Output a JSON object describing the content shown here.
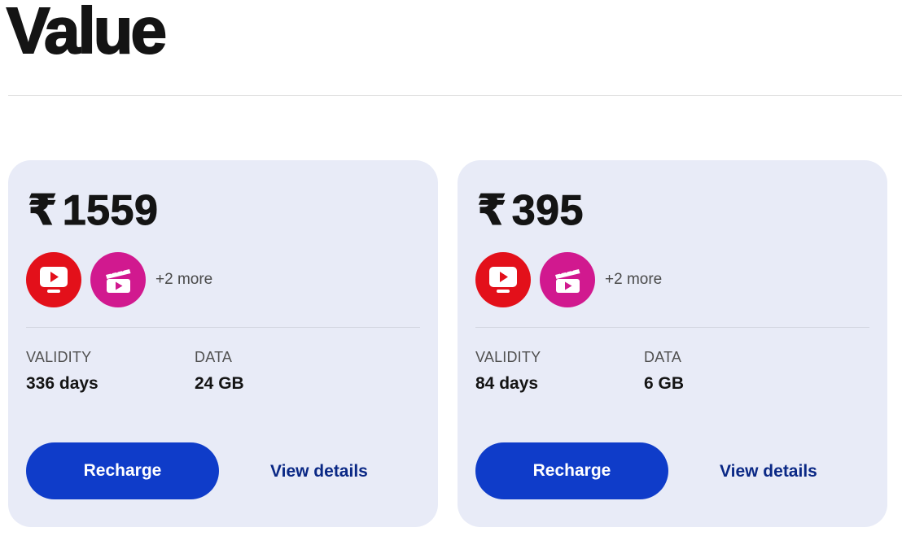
{
  "page": {
    "title": "Value"
  },
  "colors": {
    "card_background": "#e8ebf7",
    "recharge_button": "#0f3cc9",
    "link": "#0a2885",
    "tv_icon_bg": "#e3101a",
    "cinema_icon_bg": "#d1198f"
  },
  "plans": [
    {
      "currency": "₹",
      "price": "1559",
      "ott_icons": [
        "jiotv-icon",
        "jiocinema-icon"
      ],
      "more": "+2 more",
      "validity_label": "VALIDITY",
      "validity_value": "336 days",
      "data_label": "DATA",
      "data_value": "24 GB",
      "recharge_label": "Recharge",
      "details_label": "View details"
    },
    {
      "currency": "₹",
      "price": "395",
      "ott_icons": [
        "jiotv-icon",
        "jiocinema-icon"
      ],
      "more": "+2 more",
      "validity_label": "VALIDITY",
      "validity_value": "84 days",
      "data_label": "DATA",
      "data_value": "6 GB",
      "recharge_label": "Recharge",
      "details_label": "View details"
    }
  ]
}
